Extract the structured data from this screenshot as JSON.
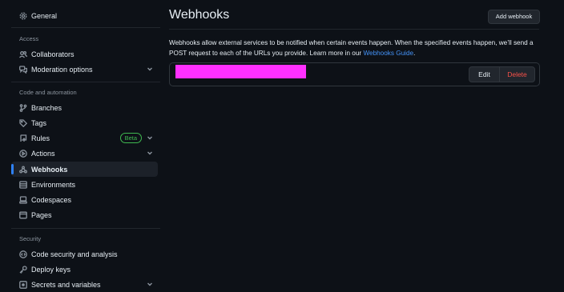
{
  "sidebar": {
    "top_items": [
      {
        "label": "General",
        "icon": "gear-icon"
      }
    ],
    "sections": [
      {
        "title": "Access",
        "items": [
          {
            "label": "Collaborators",
            "icon": "people-icon"
          },
          {
            "label": "Moderation options",
            "icon": "comment-discussion-icon",
            "expandable": true
          }
        ]
      },
      {
        "title": "Code and automation",
        "items": [
          {
            "label": "Branches",
            "icon": "git-branch-icon"
          },
          {
            "label": "Tags",
            "icon": "tag-icon"
          },
          {
            "label": "Rules",
            "icon": "repo-push-icon",
            "badge": "Beta",
            "expandable": true
          },
          {
            "label": "Actions",
            "icon": "play-icon",
            "expandable": true
          },
          {
            "label": "Webhooks",
            "icon": "webhook-icon",
            "active": true
          },
          {
            "label": "Environments",
            "icon": "server-icon"
          },
          {
            "label": "Codespaces",
            "icon": "codespaces-icon"
          },
          {
            "label": "Pages",
            "icon": "browser-icon"
          }
        ]
      },
      {
        "title": "Security",
        "items": [
          {
            "label": "Code security and analysis",
            "icon": "codescan-icon"
          },
          {
            "label": "Deploy keys",
            "icon": "key-icon"
          },
          {
            "label": "Secrets and variables",
            "icon": "asterisk-icon",
            "expandable": true
          }
        ]
      }
    ]
  },
  "main": {
    "title": "Webhooks",
    "add_button_label": "Add webhook",
    "description": "Webhooks allow external services to be notified when certain events happen. When the specified events happen, we’ll send a POST request to each of the URLs you provide. Learn more in our",
    "description_link": "Webhooks Guide",
    "description_end": ".",
    "webhook": {
      "edit_label": "Edit",
      "delete_label": "Delete"
    }
  },
  "colors": {
    "background": "#0d1117",
    "accent": "#2f81f7",
    "link": "#4493f8",
    "danger": "#f85149",
    "beta_badge": "#3fb950",
    "redaction": "#ff30ff"
  }
}
